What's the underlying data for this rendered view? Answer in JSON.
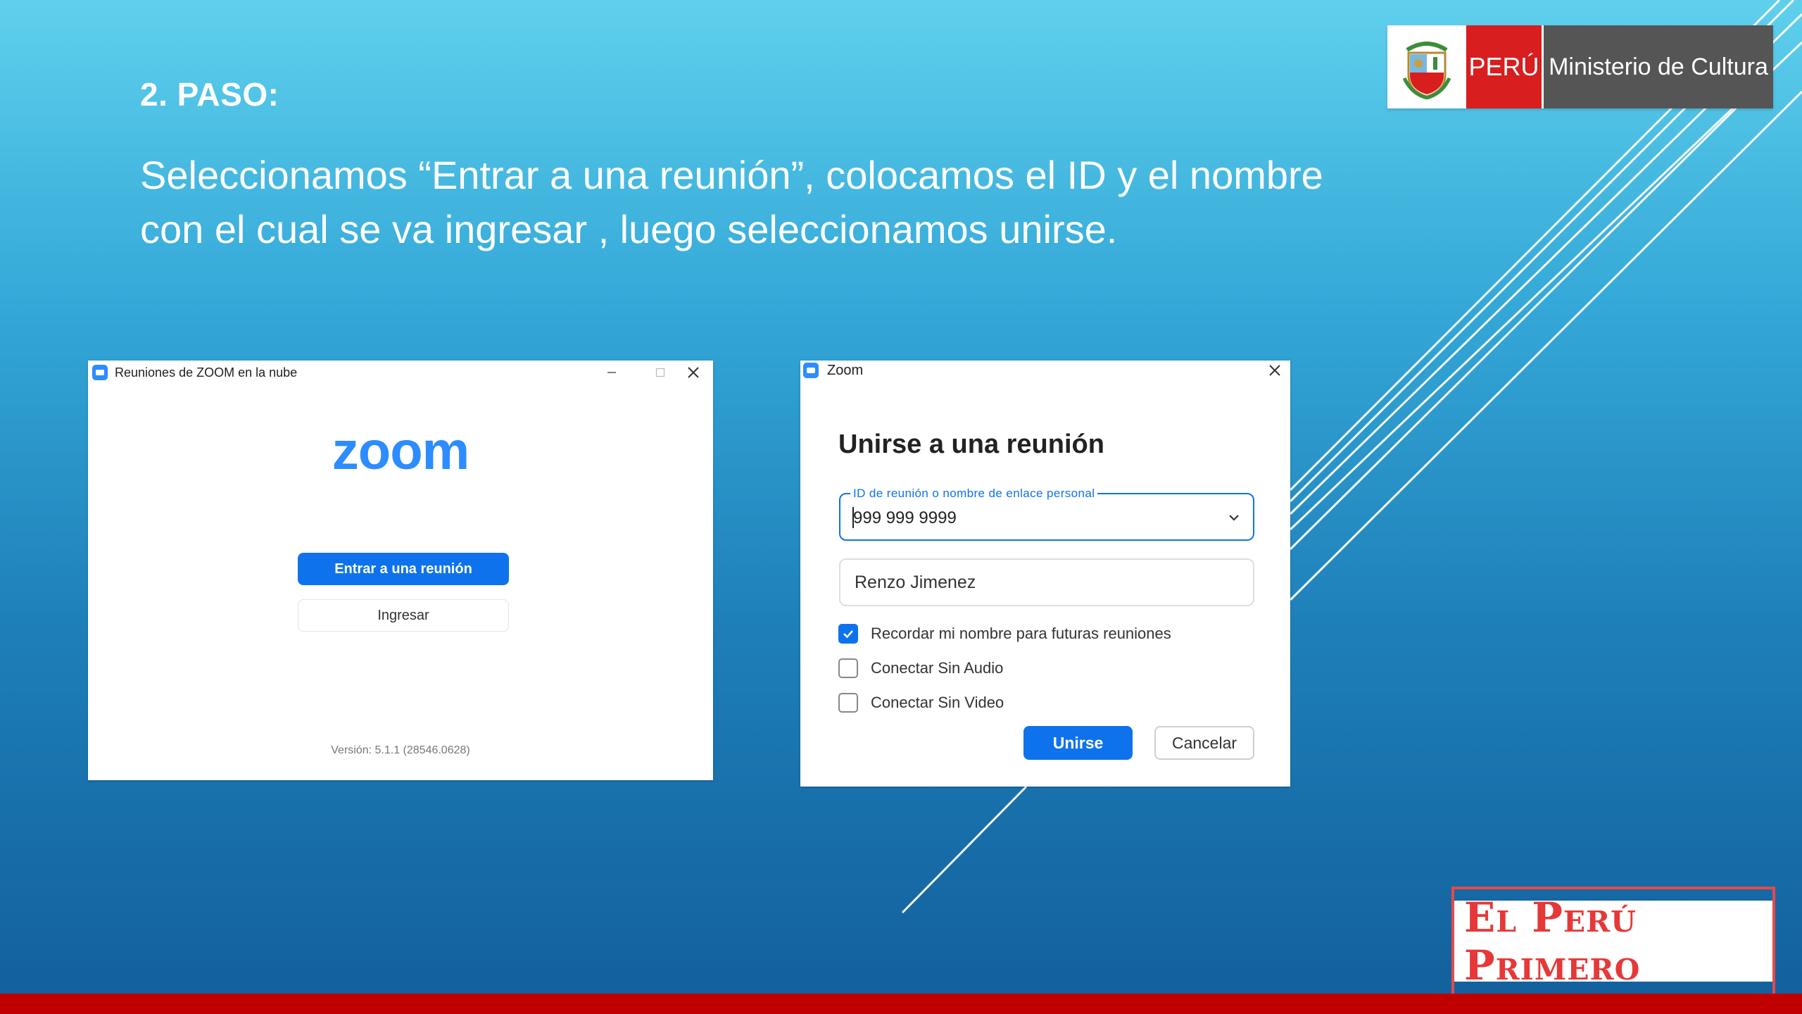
{
  "slide": {
    "step_title": "2. PASO:",
    "description_line1": "Seleccionamos “Entrar a una reunión”, colocamos el ID y el nombre",
    "description_line2": "con el cual se va ingresar , luego seleccionamos unirse."
  },
  "gov_logo": {
    "country": "PERÚ",
    "ministry": "Ministerio de Cultura",
    "emblem_icon": "coat-of-arms-icon"
  },
  "zoom_main_window": {
    "title": "Reuniones de ZOOM en la nube",
    "logo_text": "zoom",
    "join_button": "Entrar a una reunión",
    "signin_button": "Ingresar",
    "version": "Versión: 5.1.1 (28546.0628)"
  },
  "zoom_join_dialog": {
    "title": "Zoom",
    "heading": "Unirse a una reunión",
    "meeting_id_label": "ID de reunión o nombre de enlace personal",
    "meeting_id_value": "999 999 9999",
    "name_value": "Renzo Jimenez",
    "options": [
      {
        "label": "Recordar mi nombre para futuras reuniones",
        "checked": true
      },
      {
        "label": "Conectar Sin Audio",
        "checked": false
      },
      {
        "label": "Conectar Sin Video",
        "checked": false
      }
    ],
    "join_button": "Unirse",
    "cancel_button": "Cancelar"
  },
  "brand_logo": {
    "text": "El Perú Primero"
  },
  "colors": {
    "zoom_blue": "#0e72ed",
    "zoom_logo_blue": "#2d8cff",
    "peru_red": "#d81e1e",
    "bottom_bar": "#c00000",
    "bg_top": "#5fd0ec",
    "bg_bottom": "#125f9c"
  }
}
